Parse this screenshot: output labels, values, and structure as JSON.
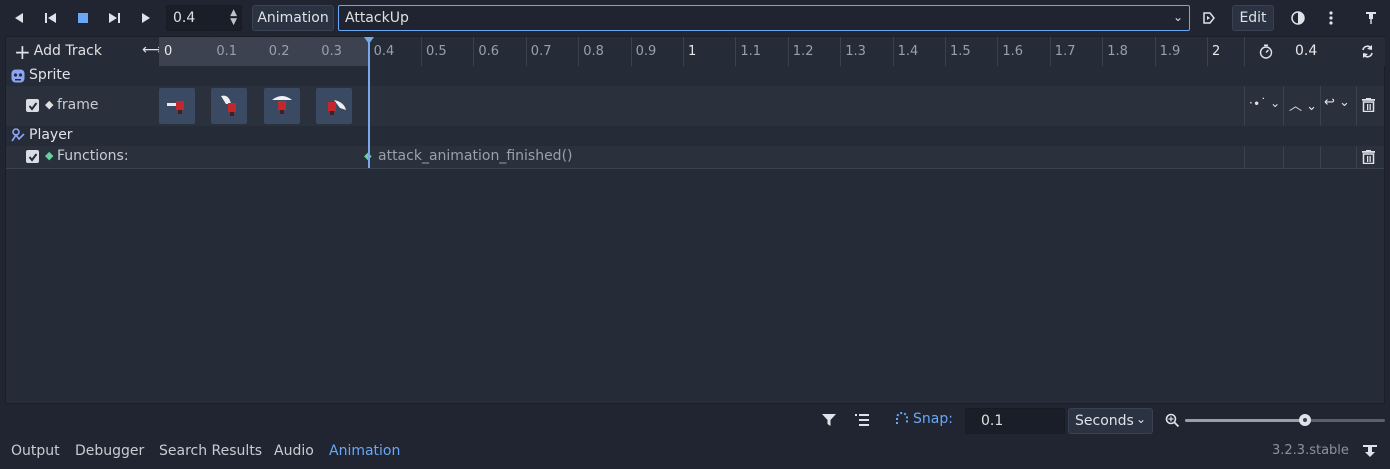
{
  "toolbar": {
    "time_value": "0.4",
    "animation_label": "Animation",
    "animation_name": "AttackUp",
    "edit_label": "Edit"
  },
  "timeline": {
    "add_track_label": "Add Track",
    "ticks": [
      "0",
      "0.1",
      "0.2",
      "0.3",
      "0.4",
      "0.5",
      "0.6",
      "0.7",
      "0.8",
      "0.9",
      "1",
      "1.1",
      "1.2",
      "1.3",
      "1.4",
      "1.5",
      "1.6",
      "1.7",
      "1.8",
      "1.9",
      "2"
    ],
    "length_value": "0.4"
  },
  "tracks": {
    "sprite_group": "Sprite",
    "frame_track": "frame",
    "player_group": "Player",
    "functions_track": "Functions:",
    "function_key_label": "attack_animation_finished()"
  },
  "bottom": {
    "snap_label": "Snap:",
    "snap_value": "0.1",
    "unit_value": "Seconds"
  },
  "status": {
    "tabs": [
      "Output",
      "Debugger",
      "Search Results",
      "Audio",
      "Animation"
    ],
    "active_tab": "Animation",
    "version": "3.2.3.stable"
  },
  "colors": {
    "accent": "#6aa7f5",
    "playhead": "#78a8e8",
    "key_green": "#63d2a0"
  }
}
